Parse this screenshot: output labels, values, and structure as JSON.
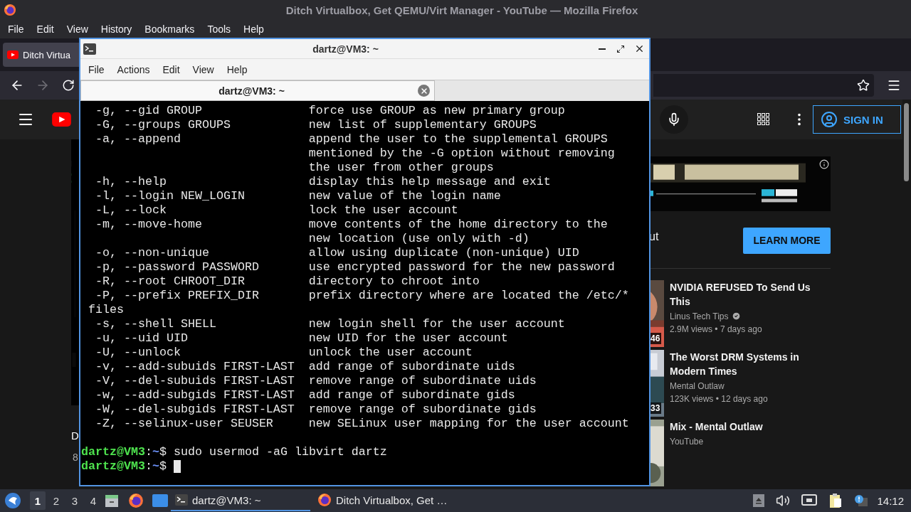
{
  "firefox": {
    "title": "Ditch Virtualbox, Get QEMU/Virt Manager - YouTube — Mozilla Firefox",
    "menu": [
      "File",
      "Edit",
      "View",
      "History",
      "Bookmarks",
      "Tools",
      "Help"
    ],
    "tabs": [
      {
        "label": "Ditch Virtua",
        "selected": true
      }
    ],
    "nav": [
      {
        "kind": "back",
        "disabled": false
      },
      {
        "kind": "forward",
        "disabled": true
      },
      {
        "kind": "reload",
        "disabled": false
      }
    ]
  },
  "youtube": {
    "sign_in": "SIGN IN",
    "video_title": "D",
    "video_meta": "8",
    "ad_text": "ut",
    "ad_button": "LEARN MORE",
    "recommendations": [
      {
        "title": "NVIDIA REFUSED To Send Us This",
        "channel": "Linus Tech Tips",
        "verified": true,
        "meta": "2.9M views • 7 days ago",
        "duration": "46"
      },
      {
        "title": "The Worst DRM Systems in Modern Times",
        "channel": "Mental Outlaw",
        "meta": "123K views • 12 days ago",
        "duration": "33"
      },
      {
        "title": "Mix - Mental Outlaw",
        "channel": "YouTube"
      }
    ]
  },
  "terminal": {
    "title": "dartz@VM3: ~",
    "menu": [
      "File",
      "Actions",
      "Edit",
      "View",
      "Help"
    ],
    "tabs": [
      {
        "label": "dartz@VM3: ~",
        "selected": true
      }
    ],
    "lines": [
      {
        "kind": "option",
        "option": "-g, --gid GROUP",
        "description": "force use GROUP as new primary group"
      },
      {
        "kind": "option",
        "option": "-G, --groups GROUPS",
        "description": "new list of supplementary GROUPS"
      },
      {
        "kind": "option",
        "option": "-a, --append",
        "description": "append the user to the supplemental GROUPS"
      },
      {
        "kind": "option",
        "description": "mentioned by the -G option without removing"
      },
      {
        "kind": "option",
        "description": "the user from other groups"
      },
      {
        "kind": "option",
        "option": "-h, --help",
        "description": "display this help message and exit"
      },
      {
        "kind": "option",
        "option": "-l, --login NEW_LOGIN",
        "description": "new value of the login name"
      },
      {
        "kind": "option",
        "option": "-L, --lock",
        "description": "lock the user account"
      },
      {
        "kind": "option",
        "option": "-m, --move-home",
        "description": "move contents of the home directory to the"
      },
      {
        "kind": "option",
        "description": "new location (use only with -d)"
      },
      {
        "kind": "option",
        "option": "-o, --non-unique",
        "description": "allow using duplicate (non-unique) UID"
      },
      {
        "kind": "option",
        "option": "-p, --password PASSWORD",
        "description": "use encrypted password for the new password"
      },
      {
        "kind": "option",
        "option": "-R, --root CHROOT_DIR",
        "description": "directory to chroot into"
      },
      {
        "kind": "option",
        "option": "-P, --prefix PREFIX_DIR",
        "description": "prefix directory where are located the /etc/*"
      },
      {
        "kind": "wrap",
        "text": "files"
      },
      {
        "kind": "option",
        "option": "-s, --shell SHELL",
        "description": "new login shell for the user account"
      },
      {
        "kind": "option",
        "option": "-u, --uid UID",
        "description": "new UID for the user account"
      },
      {
        "kind": "option",
        "option": "-U, --unlock",
        "description": "unlock the user account"
      },
      {
        "kind": "option",
        "option": "-v, --add-subuids FIRST-LAST",
        "description": "add range of subordinate uids"
      },
      {
        "kind": "option",
        "option": "-V, --del-subuids FIRST-LAST",
        "description": "remove range of subordinate uids"
      },
      {
        "kind": "option",
        "option": "-w, --add-subgids FIRST-LAST",
        "description": "add range of subordinate gids"
      },
      {
        "kind": "option",
        "option": "-W, --del-subgids FIRST-LAST",
        "description": "remove range of subordinate gids"
      },
      {
        "kind": "option",
        "option": "-Z, --selinux-user SEUSER",
        "description": "new SELinux user mapping for the user account"
      },
      {
        "kind": "blank"
      },
      {
        "kind": "prompt",
        "user": "dartz@VM3",
        "separator": ":",
        "path": "~",
        "symbol": "$",
        "command": "sudo usermod -aG libvirt dartz"
      },
      {
        "kind": "prompt",
        "user": "dartz@VM3",
        "separator": ":",
        "path": "~",
        "symbol": "$",
        "cursor": true
      }
    ]
  },
  "taskbar": {
    "workspaces": [
      {
        "label": "1",
        "selected": true
      },
      {
        "label": "2",
        "selected": false
      },
      {
        "label": "3",
        "selected": false
      },
      {
        "label": "4",
        "selected": false
      }
    ],
    "tasks": [
      {
        "kind": "terminal",
        "label": "dartz@VM3: ~",
        "selected": true
      },
      {
        "kind": "firefox",
        "label": "Ditch Virtualbox, Get …",
        "selected": false
      }
    ],
    "clock": "14:12"
  }
}
